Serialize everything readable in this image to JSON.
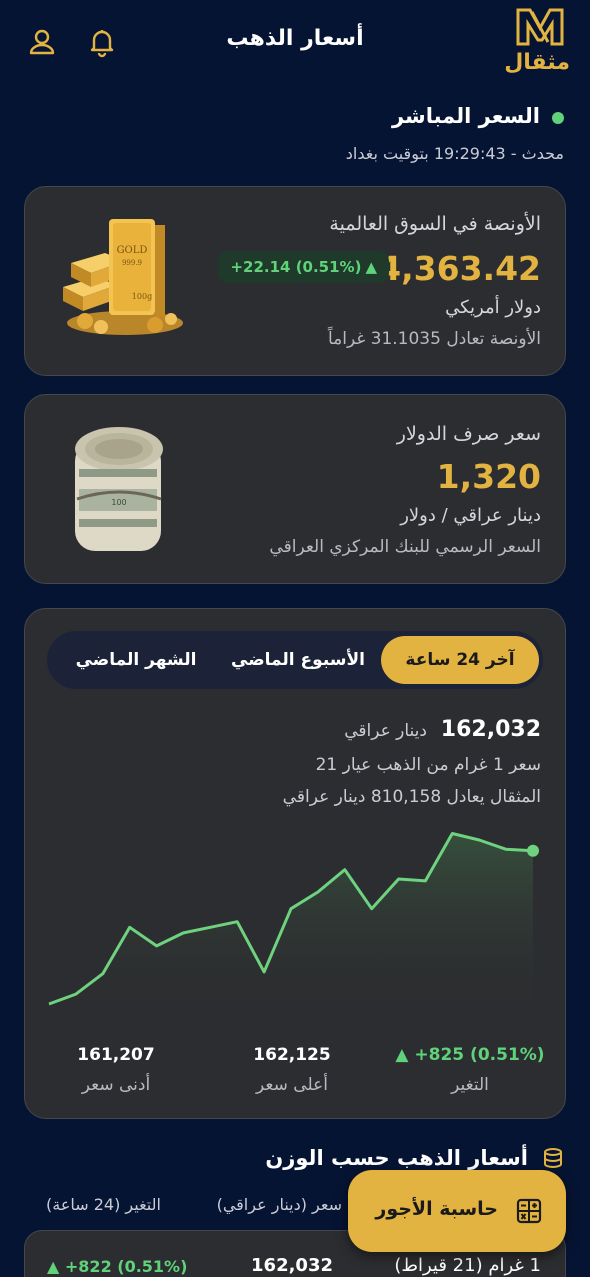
{
  "header": {
    "logo_text": "مثقال",
    "title": "أسعار الذهب",
    "icons": [
      "bell-icon",
      "user-icon"
    ]
  },
  "live": {
    "title": "السعر المباشر",
    "updated": "محدث - 19:29:43 بتوقيت بغداد"
  },
  "ounce_card": {
    "label": "الأونصة في السوق العالمية",
    "price": "4,363.42",
    "change": "+22.14 (0.51%)",
    "currency": "دولار أمريكي",
    "note": "الأونصة تعادل 31.1035 غراماً"
  },
  "usd_card": {
    "label": "سعر صرف الدولار",
    "price": "1,320",
    "unit": "دينار عراقي / دولار",
    "note": "السعر الرسمي للبنك المركزي العراقي"
  },
  "chart_card": {
    "tabs": [
      {
        "label": "آخر 24 ساعة",
        "active": true
      },
      {
        "label": "الأسبوع الماضي",
        "active": false
      },
      {
        "label": "الشهر الماضي",
        "active": false
      }
    ],
    "price": "162,032",
    "unit": "دينار عراقي",
    "line2": "سعر 1 غرام من الذهب عيار 21",
    "line3": "المثقال يعادل 810,158 دينار عراقي",
    "stats": [
      {
        "value": "+825 (0.51%)",
        "label": "التغير"
      },
      {
        "value": "162,125",
        "label": "أعلى سعر"
      },
      {
        "value": "161,207",
        "label": "أدنى سعر"
      }
    ]
  },
  "chart_data": {
    "type": "area",
    "x": [
      0,
      1,
      2,
      3,
      4,
      5,
      6,
      7,
      8,
      9,
      10,
      11,
      12,
      13,
      14,
      15,
      16,
      17,
      18
    ],
    "values": [
      161207,
      161260,
      161370,
      161620,
      161520,
      161590,
      161620,
      161650,
      161380,
      161720,
      161810,
      161930,
      161720,
      161880,
      161870,
      162125,
      162090,
      162040,
      162032
    ],
    "color": "#6fd27f",
    "ylim": [
      161180,
      162160
    ]
  },
  "weight_section": {
    "title": "أسعار الذهب حسب الوزن",
    "col_price": "سعر (دينار عراقي)",
    "col_change": "التغير (24 ساعة)",
    "rows": [
      {
        "name": "1 غرام (21 قيراط)",
        "price": "162,032",
        "change": "+822 (0.51%)"
      }
    ]
  },
  "calc_button": {
    "label": "حاسبة الأجور"
  }
}
